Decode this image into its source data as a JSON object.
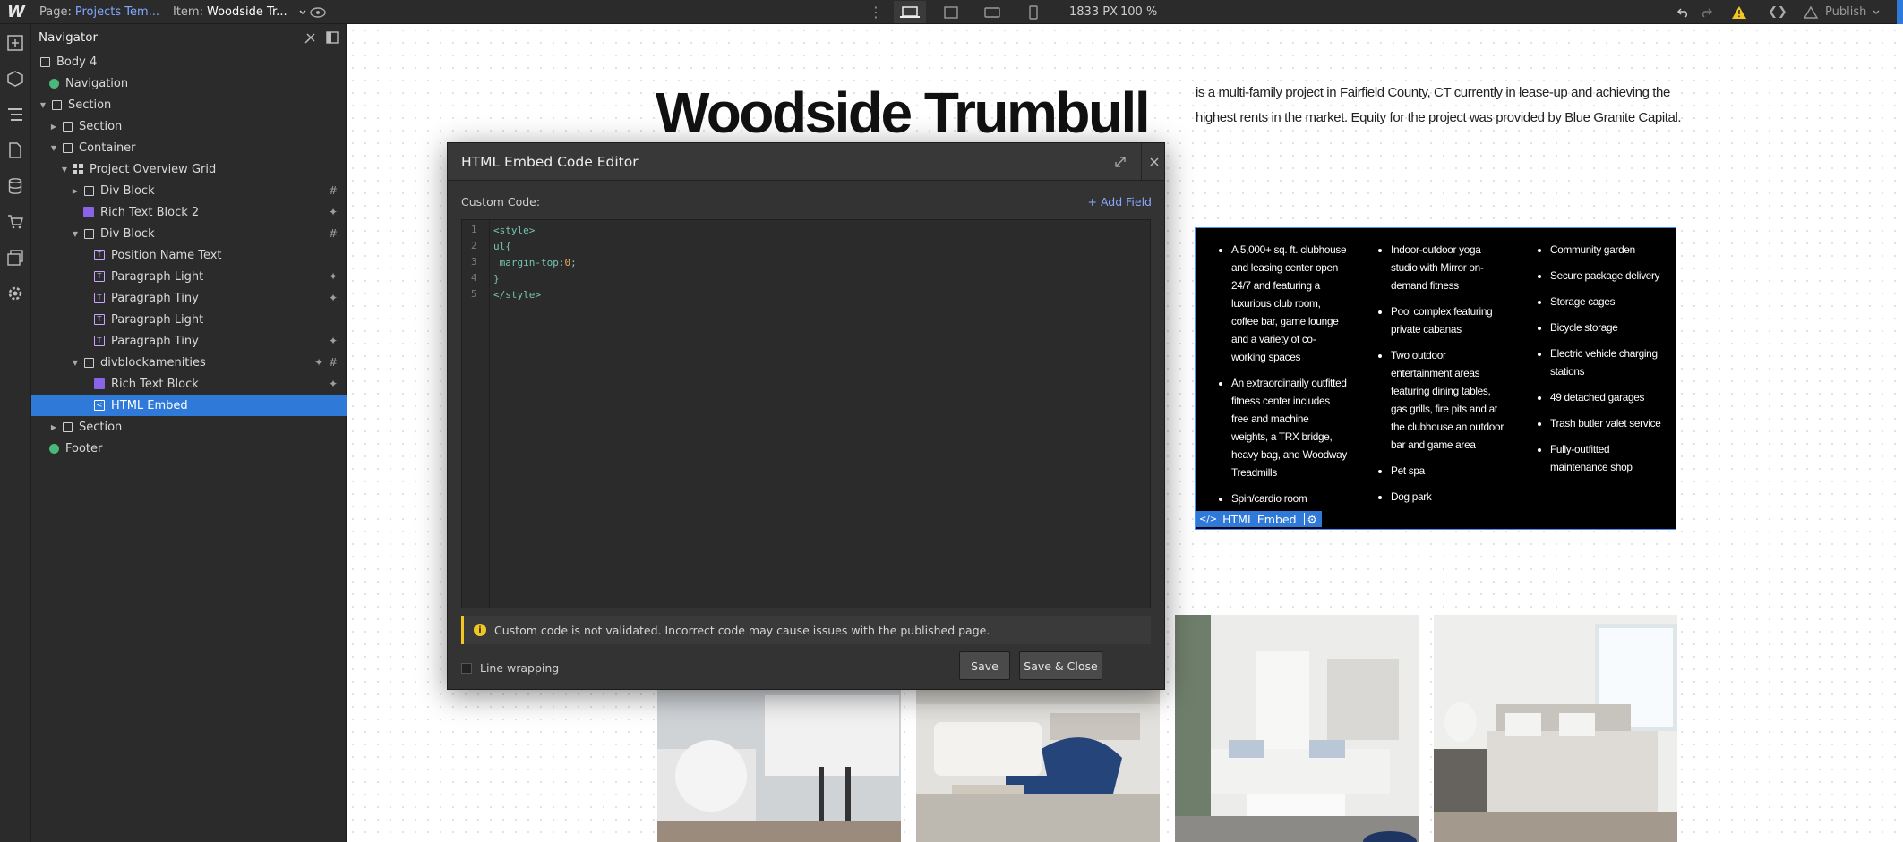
{
  "topbar": {
    "page_label": "Page:",
    "page_value": "Projects Tem...",
    "item_label": "Item:",
    "item_value": "Woodside Tr...",
    "canvas_width": "1833",
    "width_unit": "PX",
    "zoom": "100 %",
    "publish_label": "Publish"
  },
  "navigator": {
    "title": "Navigator",
    "rows": [
      {
        "label": "Body 4",
        "icon": "body-icon"
      },
      {
        "label": "Navigation",
        "icon": "symbol-icon"
      },
      {
        "label": "Section",
        "icon": "box-icon"
      },
      {
        "label": "Section",
        "icon": "box-icon"
      },
      {
        "label": "Container",
        "icon": "box-icon"
      },
      {
        "label": "Project Overview Grid",
        "icon": "grid-icon"
      },
      {
        "label": "Div Block",
        "icon": "box-icon",
        "badge": "#"
      },
      {
        "label": "Rich Text Block 2",
        "icon": "rich-text-icon",
        "badge": "✦"
      },
      {
        "label": "Div Block",
        "icon": "box-icon",
        "badge": "#"
      },
      {
        "label": "Position Name Text",
        "icon": "text-icon"
      },
      {
        "label": "Paragraph Light",
        "icon": "text-icon",
        "badge": "✦"
      },
      {
        "label": "Paragraph Tiny",
        "icon": "text-icon",
        "badge": "✦"
      },
      {
        "label": "Paragraph Light",
        "icon": "text-icon"
      },
      {
        "label": "Paragraph Tiny",
        "icon": "text-icon",
        "badge": "✦"
      },
      {
        "label": "divblockamenities",
        "icon": "box-icon",
        "badge": "#",
        "badge2": "✦"
      },
      {
        "label": "Rich Text Block",
        "icon": "rich-text-icon",
        "badge": "✦"
      },
      {
        "label": "HTML Embed",
        "icon": "embed-icon",
        "selected": true
      },
      {
        "label": "Section",
        "icon": "box-icon"
      },
      {
        "label": "Footer",
        "icon": "symbol-icon"
      }
    ]
  },
  "canvas": {
    "title": "Woodside Trumbull",
    "intro": "is a multi-family project in Fairfield County, CT currently in lease-up and achieving the highest rents in the market. Equity for the project was provided by Blue Granite Capital.",
    "amenities": {
      "col1": [
        "A 5,000+ sq. ft. clubhouse and leasing center open 24/7 and featuring a luxurious club room, coffee bar, game lounge and a variety of co-working spaces",
        "An extraordinarily outfitted fitness center includes free and machine weights, a TRX bridge, heavy bag, and Woodway Treadmills",
        "Spin/cardio room"
      ],
      "col2": [
        "Indoor-outdoor yoga studio with Mirror on-demand fitness",
        "Pool complex featuring private cabanas",
        "Two outdoor entertainment areas featuring dining tables, gas grills, fire pits and at the clubhouse an outdoor bar and game area",
        "Pet spa",
        "Dog park"
      ],
      "col3": [
        "Community garden",
        "Secure package delivery",
        "Storage cages",
        "Bicycle storage",
        "Electric vehicle charging stations",
        "49 detached garages",
        "Trash butler valet service",
        "Fully-outfitted maintenance shop"
      ]
    },
    "embed_tag": "HTML Embed"
  },
  "modal": {
    "title": "HTML Embed Code Editor",
    "custom_code_label": "Custom Code:",
    "add_field": "+ Add Field",
    "code_lines": [
      "<style>",
      "ul{",
      " margin-top:",
      "}",
      "</style>"
    ],
    "code_number": "0",
    "code_semicolon": ";",
    "line_numbers": [
      "1",
      "2",
      "3",
      "4",
      "5"
    ],
    "warning": "Custom code is not validated. Incorrect code may cause issues with the published page.",
    "line_wrapping": "Line wrapping",
    "save": "Save",
    "save_close": "Save & Close"
  },
  "colors": {
    "accent": "#2f7ad9",
    "warning": "#f3c623",
    "code": "#79c3b1",
    "panel": "#2b2b2b"
  }
}
